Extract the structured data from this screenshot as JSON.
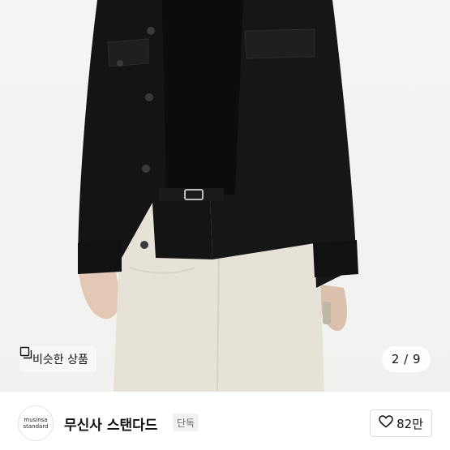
{
  "colors": {
    "jacket": "#141414",
    "pants": "#e6e2d8",
    "skin": "#e3c8b6",
    "background": "#f3f3f2",
    "badge_bg": "#f1f1f1"
  },
  "image": {
    "similar_button_label": "비슷한 상품",
    "similar_icon": "copy-icon",
    "counter": "2 / 9"
  },
  "brand": {
    "logo_line1": "musinsa",
    "logo_line2": "standard",
    "name": "무신사 스탠다드",
    "badge": "단독",
    "like_icon": "heart-icon",
    "like_count": "82만"
  }
}
